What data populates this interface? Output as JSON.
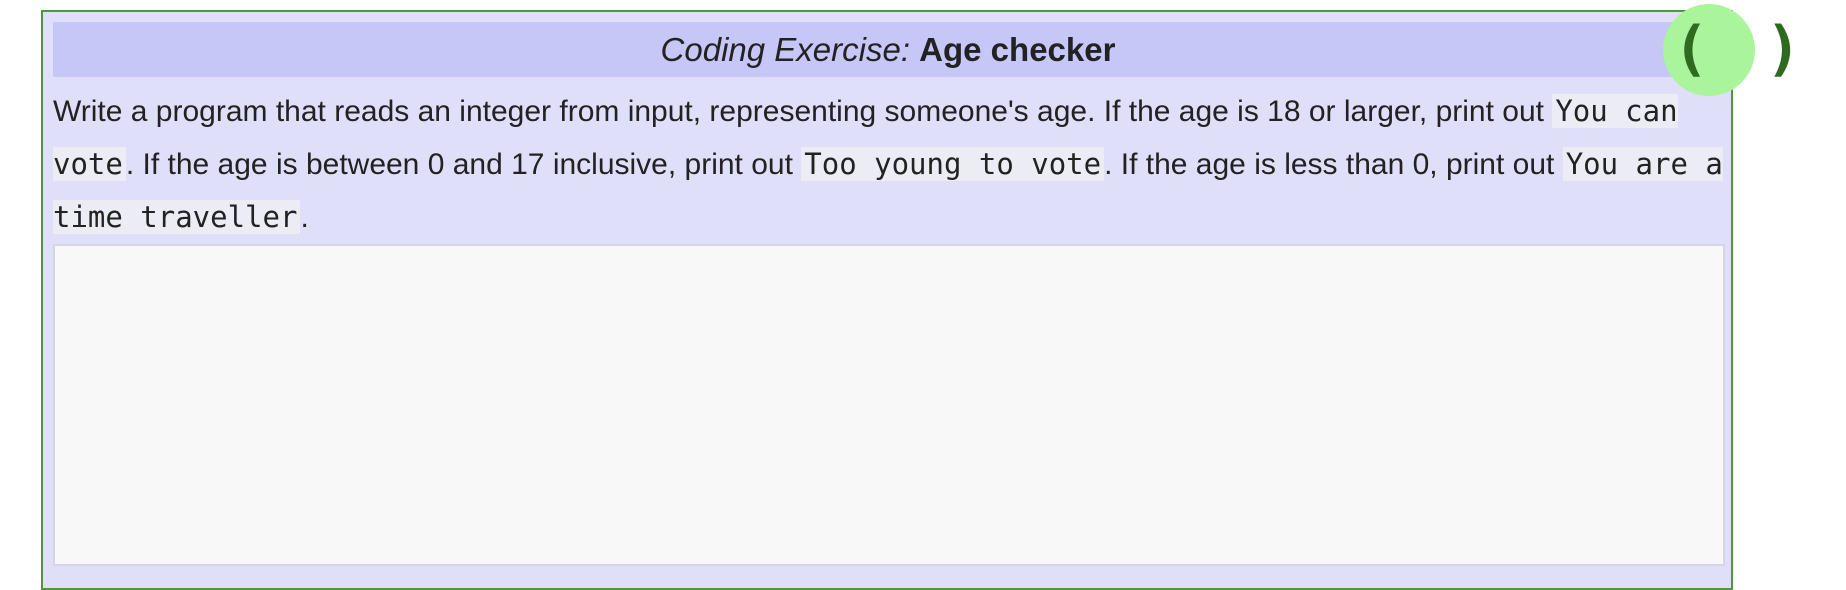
{
  "exercise": {
    "header_prefix": "Coding Exercise:",
    "header_name": "Age checker",
    "text_1": "Write a program that reads an integer from input, representing someone's age. If the age is 18 or larger, print out ",
    "code_1": "You can vote",
    "text_2": ". If the age is between 0 and 17 inclusive, print out ",
    "code_2": "Too young to vote",
    "text_3": ". If the age is less than 0, print out ",
    "code_3": "You are a time traveller",
    "text_4": "."
  },
  "run_button": {
    "label": "( )",
    "icon": "parentheses-icon",
    "color": "#aaf59c"
  },
  "editor": {
    "value": ""
  },
  "colors": {
    "box_background": "#dfdffa",
    "header_background": "#c6c6f7",
    "border": "#4a9a3c"
  }
}
